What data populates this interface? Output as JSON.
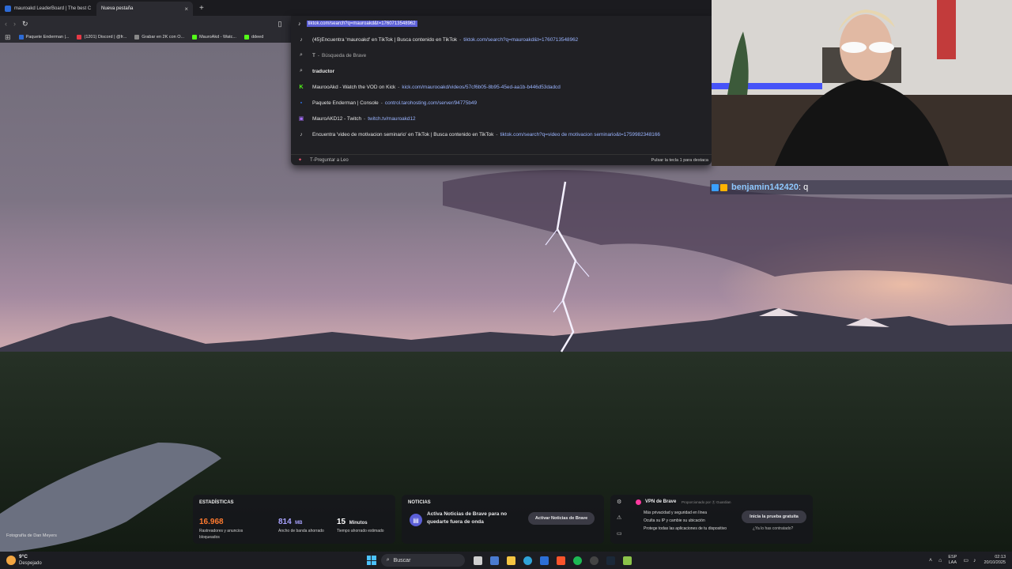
{
  "tabs": [
    {
      "title": "mauroakd LeaderBoard | The best C",
      "active": false
    },
    {
      "title": "Nueva pestaña",
      "active": true,
      "close": "×"
    }
  ],
  "new_tab_label": "+",
  "bookmarks": [
    {
      "label": "Paquete Enderman |...",
      "color": "#2d6bd6"
    },
    {
      "label": "(1201) Discord | @fr...",
      "color": "#e63946"
    },
    {
      "label": "Grabar en 2K con O...",
      "color": "#888888"
    },
    {
      "label": "MauroAkd - Watc...",
      "color": "#53fc18"
    },
    {
      "label": "ddeed",
      "color": "#53fc18"
    }
  ],
  "omnibox": {
    "value": "tiktok.com/search?q=mauroakd&t=1760713548962",
    "suggestions": [
      {
        "icon": "tiktok-icon",
        "glyph": "♪",
        "text": "(45)Encuentra 'mauroakd' en TikTok | Busca contenido en TikTok",
        "sep": " - ",
        "url": "tiktok.com/search?q=mauroakd&t=1760713548962"
      },
      {
        "icon": "search-icon",
        "glyph": "⌕",
        "text": "T",
        "sep": " - ",
        "muted": "Búsqueda de Brave"
      },
      {
        "icon": "search-icon",
        "glyph": "⌕",
        "text": "traductor",
        "bold": true
      },
      {
        "icon": "kick-icon",
        "glyph": "K",
        "text": "MaurooAkd - Watch the VOD on Kick",
        "sep": " - ",
        "url": "kick.com/maurooakd/videos/57cf6b05-8b95-45ed-aa1b-b446d53dadcd"
      },
      {
        "icon": "server-icon",
        "glyph": "▪",
        "text": "Paquete Enderman | Console",
        "sep": " - ",
        "url": "control.tarohosting.com/server/94775b49"
      },
      {
        "icon": "twitch-icon",
        "glyph": "▣",
        "text": "MauroAKD12 - Twitch",
        "sep": " - ",
        "url": "twitch.tv/mauroakd12"
      },
      {
        "icon": "tiktok-icon",
        "glyph": "♪",
        "text": "Encuentra 'video de motivacion seminario' en TikTok | Busca contenido en TikTok",
        "sep": " - ",
        "url": "tiktok.com/search?q=video de motivacion seminario&t=1759982348166"
      }
    ],
    "footer": {
      "text": "T",
      "sep": " - ",
      "muted": "Preguntar a Leo",
      "hint": "Pulsar la tecla 1 para destaca"
    }
  },
  "chat": {
    "user": "benjamin142420",
    "sep": " : ",
    "message": "q"
  },
  "stats": {
    "title": "ESTADÍSTICAS",
    "items": [
      {
        "value": "16.968",
        "unit": "",
        "label": "Rastreadores y anuncios bloqueados",
        "color": "#ff7a2f"
      },
      {
        "value": "814",
        "unit": "MB",
        "label": "Ancho de banda ahorrado",
        "color": "#a9a3ff"
      },
      {
        "value": "15",
        "unit": "Minutos",
        "label": "Tiempo ahorrado estimado",
        "color": "#ffffff"
      }
    ]
  },
  "news": {
    "title": "NOTICIAS",
    "text": "Activa Noticias de Brave para no quedarte fuera de onda",
    "button": "Activar Noticias de Brave"
  },
  "vpn": {
    "title": "VPN de Brave",
    "sponsor": "Proporcionado por ⓖ Guardian",
    "bullets": [
      "Más privacidad y seguridad en línea",
      "Oculta su IP y cambie su ubicación",
      "Protege todas las aplicaciones de tu dispositivo"
    ],
    "button": "Inicia la prueba gratuita",
    "link": "¿Ya lo has contratado?"
  },
  "photo_credit": "Fotografía de Dan Meyers",
  "taskbar": {
    "weather_temp": "9°C",
    "weather_desc": "Despejado",
    "search": "Buscar",
    "lang1": "ESP",
    "lang2": "LAA",
    "time": "02:13",
    "date": "20/10/2025"
  }
}
